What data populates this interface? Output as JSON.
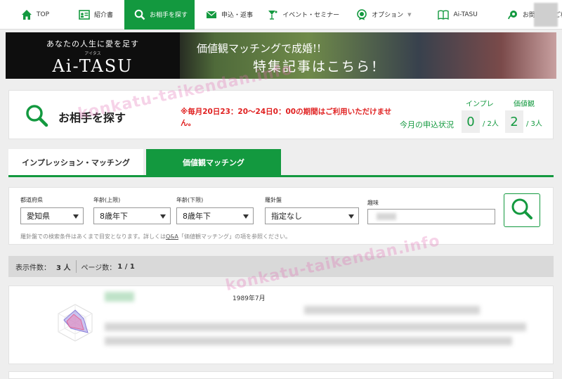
{
  "nav": {
    "items": [
      {
        "label": "TOP",
        "icon": "home-icon"
      },
      {
        "label": "紹介書",
        "icon": "profile-card-icon"
      },
      {
        "label": "お相手を探す",
        "icon": "search-icon"
      },
      {
        "label": "申込・返事",
        "icon": "mail-icon"
      },
      {
        "label": "イベント・セミナー",
        "icon": "event-glass-icon"
      },
      {
        "label": "オプション",
        "icon": "option-badge-icon"
      },
      {
        "label": "Ai-TASU",
        "icon": "book-icon"
      },
      {
        "label": "お問合せ・ご相談",
        "icon": "support-icon"
      }
    ],
    "active_index": 2
  },
  "banner": {
    "tagline": "あなたの人生に愛を足す",
    "ruby": "アイタス",
    "brand": "Ai-TASU",
    "line1": "価値観マッチングで成婚!!",
    "line2": "特集記事はこちら！"
  },
  "header": {
    "title": "お相手を探す",
    "notice": "※毎月20日23：20〜24日0：00の期間はご利用いただけません。",
    "status_label": "今月の申込状況",
    "impression": {
      "label": "インプレ",
      "used": "0",
      "total": "/ 2人"
    },
    "values": {
      "label": "価値観",
      "used": "2",
      "total": "/ 3人"
    }
  },
  "tabs": {
    "impression": "インプレッション・マッチング",
    "values": "価値観マッチング"
  },
  "filters": {
    "prefecture": {
      "label": "都道府県",
      "value": "愛知県"
    },
    "age_upper": {
      "label": "年齢(上限)",
      "value": "8歳年下"
    },
    "age_lower": {
      "label": "年齢(下限)",
      "value": "8歳年下"
    },
    "compass": {
      "label": "羅針盤",
      "value": "指定なし"
    },
    "hobby": {
      "label": "趣味"
    },
    "note_before": "羅針盤での検索条件はあくまで目安となります。詳しくは",
    "note_link": "Q&A",
    "note_after": "「価値観マッチング」の項を参照ください。"
  },
  "results": {
    "count_label": "表示件数：",
    "count": "3 人",
    "page_label": "ページ数：",
    "page": "1 / 1"
  },
  "result_card": {
    "birth": "1989年7月"
  },
  "watermark": {
    "text1": "konkatu-taikendan.info",
    "text2": "konkatu-taikendan.info"
  },
  "colors": {
    "brand_green": "#13993f",
    "notice_red": "#e02020"
  }
}
